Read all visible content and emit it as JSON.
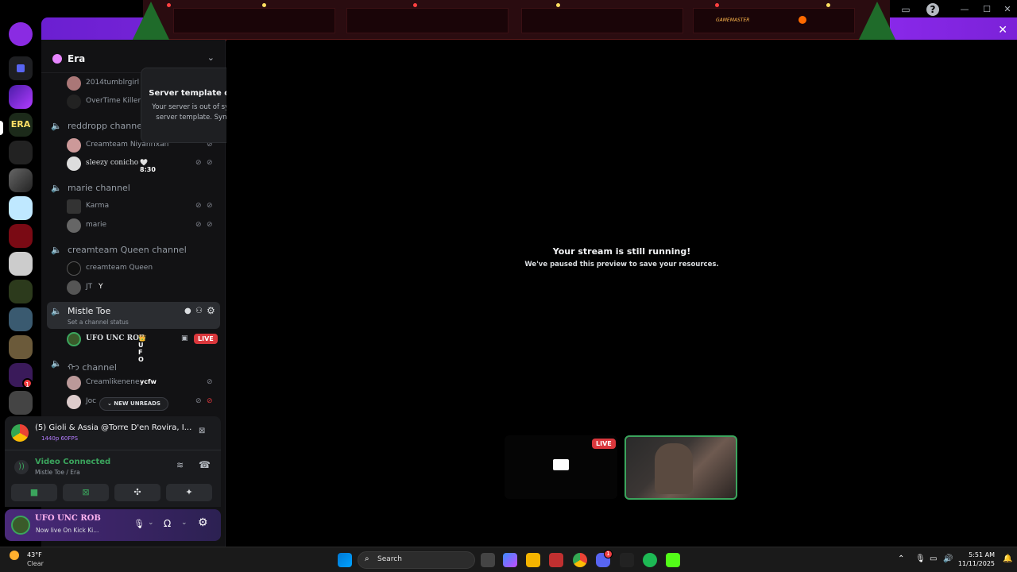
{
  "server": {
    "name": "Era"
  },
  "popover": {
    "title": "Server template out of sync",
    "body": "Your server is out of sync with your server template. Sync template?"
  },
  "channels": {
    "top_members": [
      {
        "name": "2014tumblrgirl"
      },
      {
        "name": "OverTime Killer"
      }
    ],
    "reddropp": {
      "name": "reddropp channel",
      "members": [
        {
          "name": "Creamteam Niyahrixan"
        },
        {
          "name": "sleezy conicho",
          "tag": "🤍8:30"
        }
      ]
    },
    "marie": {
      "name": "marie channel",
      "members": [
        {
          "name": "Karma"
        },
        {
          "name": "marie"
        }
      ]
    },
    "creamteam": {
      "name": "creamteam Queen channel",
      "members": [
        {
          "name": "creamteam Queen"
        },
        {
          "name": "JT",
          "tag": "Y"
        }
      ]
    },
    "mistle": {
      "name": "Mistle Toe",
      "status_placeholder": "Set a channel status",
      "member": {
        "name": "𝐔𝐅𝐎 UNC ROB",
        "tag": "👑 U F O",
        "live": "LIVE"
      }
    },
    "ji": {
      "name": "ᡣ𐭩 channel",
      "members": [
        {
          "name": "Creamlikenene",
          "tag": "ycfw"
        },
        {
          "name": "Joc"
        }
      ]
    },
    "new_unreads": "NEW UNREADS"
  },
  "activity": {
    "title": "(5) Gioli & Assia @Torre D'en Rovira, I...",
    "sub": "1440p 60FPS"
  },
  "voice": {
    "status": "Video Connected",
    "location": "Mistle Toe / Era"
  },
  "user": {
    "name": "𝐔𝐅𝐎 UNC ROB",
    "status": "Now live On Kick Ki..."
  },
  "stage": {
    "title": "Your stream is still running!",
    "subtitle": "We've paused this preview to save your resources.",
    "live": "LIVE"
  },
  "banner": {
    "tag": "GAMEMASTER"
  },
  "taskbar": {
    "weather_temp": "43°F",
    "weather_desc": "Clear",
    "search": "Search",
    "time": "5:51 AM",
    "date": "11/11/2025"
  },
  "badges": {
    "rail": "1",
    "taskbar_discord": "1"
  },
  "colors": {
    "accent_green": "#3ba55d",
    "live_red": "#da373c",
    "banner_purple": "#8a2be2"
  }
}
